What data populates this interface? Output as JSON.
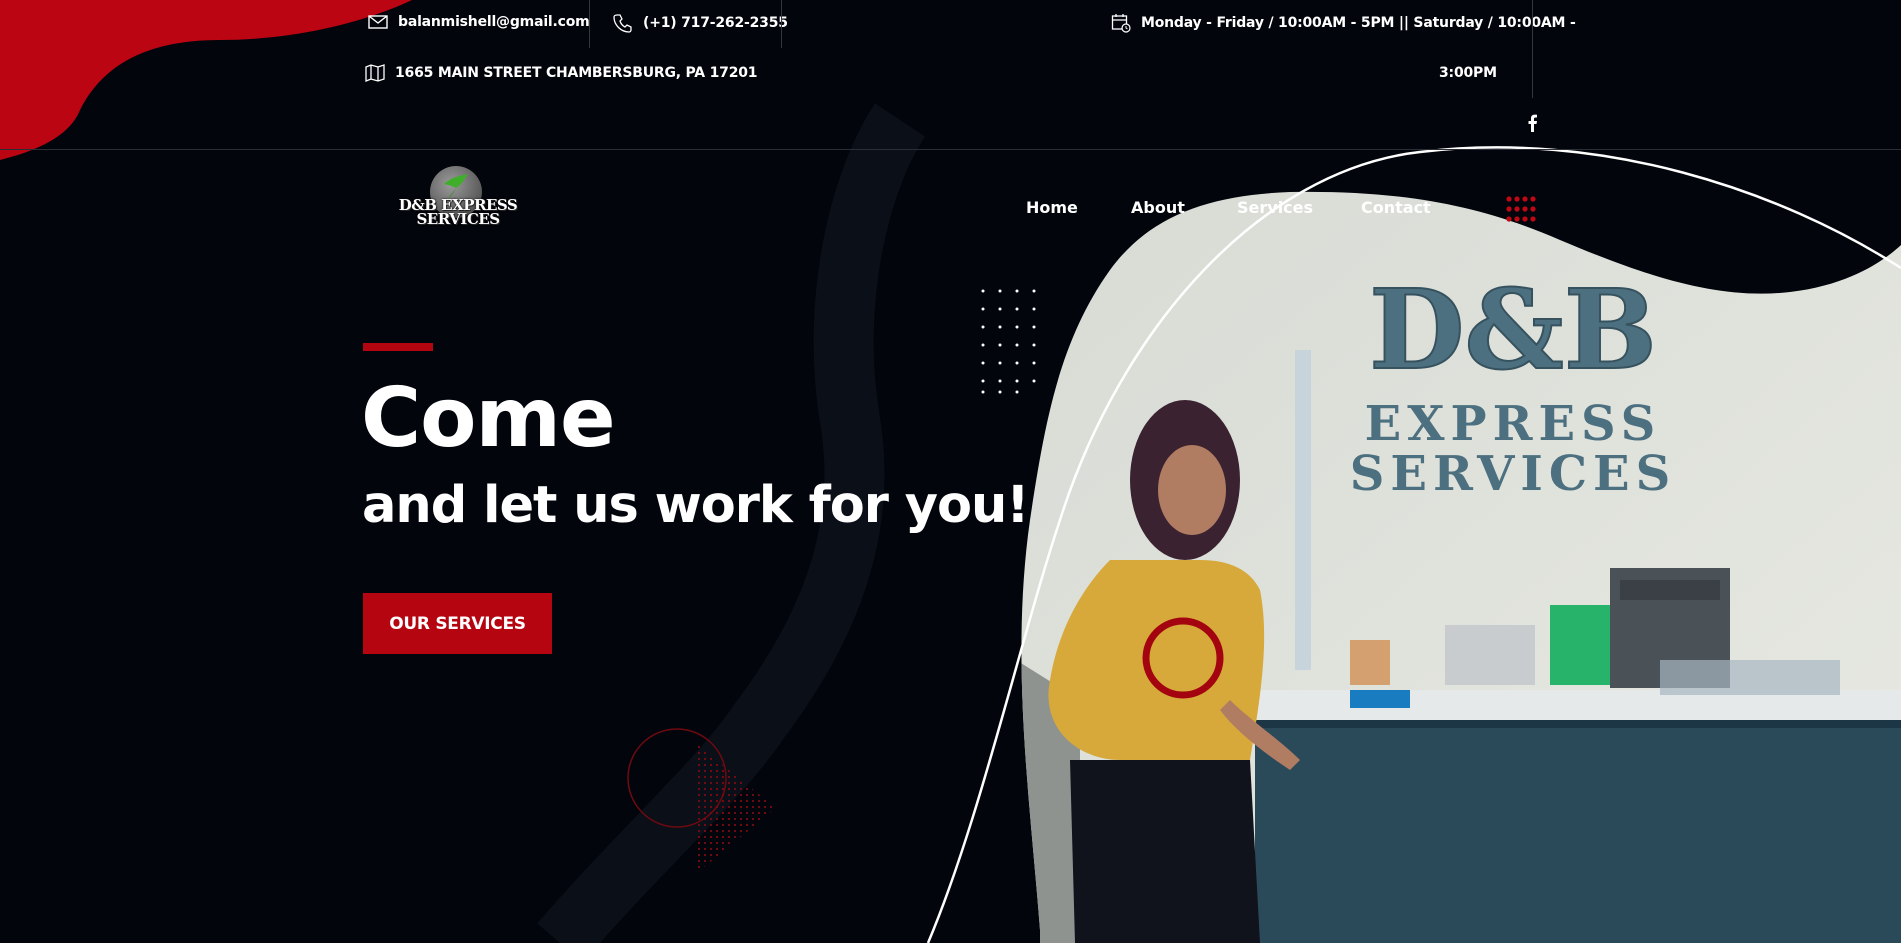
{
  "topbar": {
    "email": "balanmishell@gmail.com",
    "phone": "(+1) 717-262-2355",
    "address": "1665 MAIN STREET CHAMBERSBURG, PA 17201",
    "hours_line1": "Monday - Friday / 10:00AM - 5PM || Saturday / 10:00AM -",
    "hours_line2": "3:00PM",
    "icons": {
      "email": "envelope-icon",
      "phone": "phone-icon",
      "address": "map-icon",
      "hours": "calendar-clock-icon",
      "social": "facebook-icon"
    }
  },
  "logo": {
    "line1": "D&B EXPRESS",
    "line2": "SERVICES"
  },
  "nav": {
    "items": [
      "Home",
      "About",
      "Services",
      "Contact"
    ],
    "menu_icon": "grid-dots-icon"
  },
  "hero": {
    "title": "Come",
    "subtitle": "and let us work for you!",
    "cta_label": "OUR SERVICES"
  },
  "photo": {
    "sign_line1": "D&B",
    "sign_line2": "EXPRESS",
    "sign_line3": "SERVICES"
  },
  "colors": {
    "background": "#03050c",
    "accent_red": "#b50510",
    "text": "#ffffff"
  }
}
